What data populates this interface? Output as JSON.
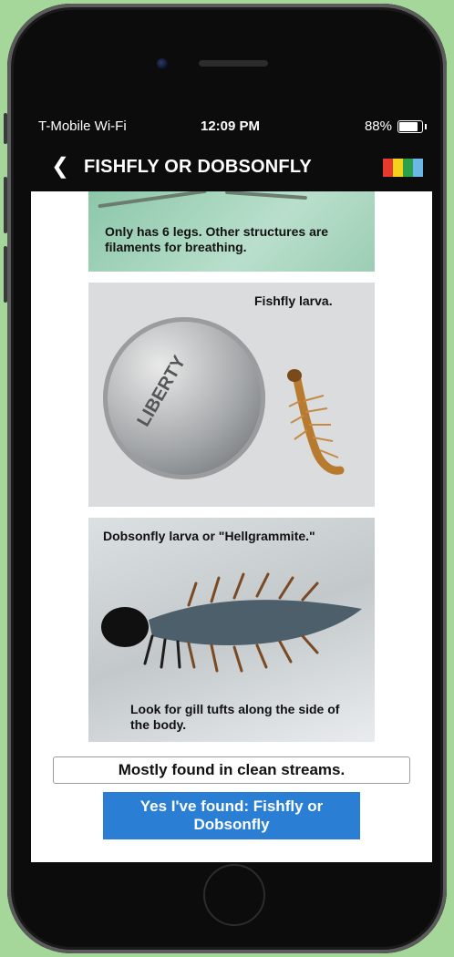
{
  "status_bar": {
    "carrier": "T-Mobile Wi-Fi",
    "time": "12:09 PM",
    "battery": "88%"
  },
  "nav": {
    "back_icon": "chevron-left-icon",
    "title": "FISHFLY OR DOBSONFLY",
    "flag_colors": [
      "#e63a2e",
      "#f5d21a",
      "#2c9f4a",
      "#6ab7e8"
    ]
  },
  "cards": {
    "top_caption": "Only has 6 legs. Other structures are filaments for breathing.",
    "fishfly_caption": "Fishfly larva.",
    "coin_text": "LIBERTY",
    "dobsonfly_caption": "Dobsonfly larva or \"Hellgrammite.\"",
    "gill_caption": "Look for gill tufts along the side of the body."
  },
  "habitat": "Mostly found in clean streams.",
  "confirm_button": "Yes I've found: Fishfly or Dobsonfly"
}
